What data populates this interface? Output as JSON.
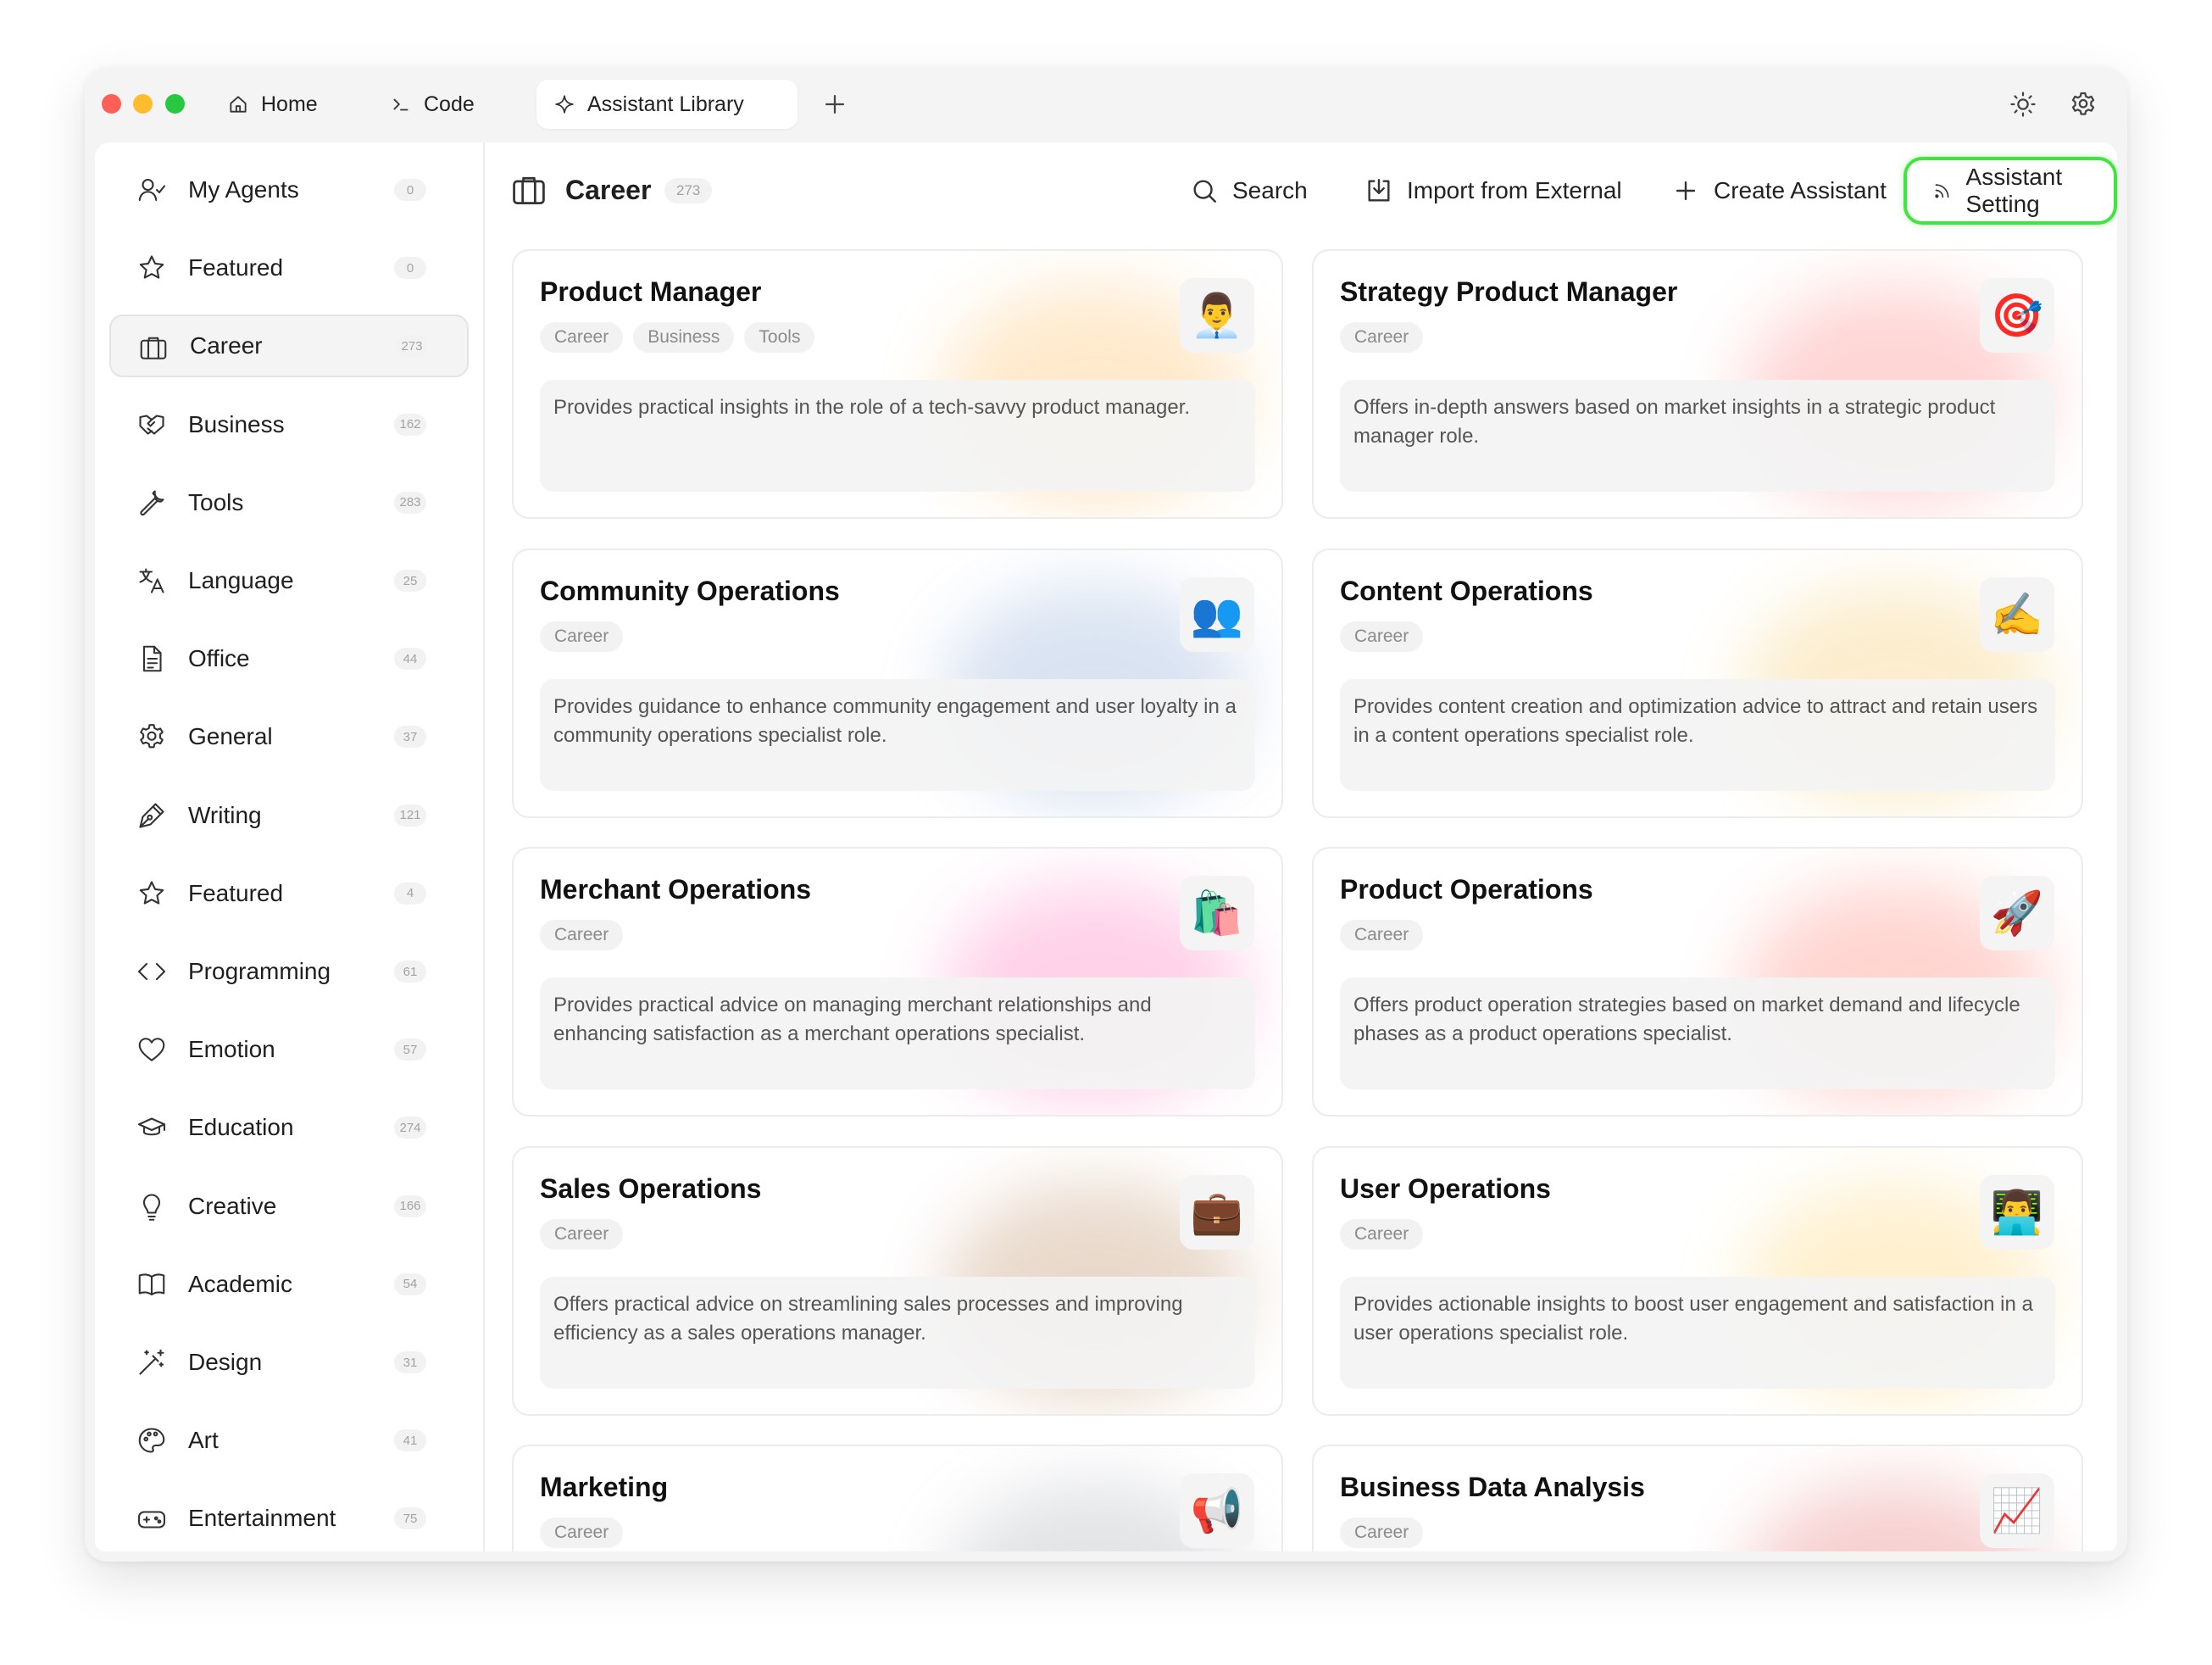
{
  "tabs": [
    {
      "label": "Home",
      "icon": "home-icon"
    },
    {
      "label": "Code",
      "icon": "terminal-icon"
    },
    {
      "label": "Assistant Library",
      "icon": "sparkle-icon"
    }
  ],
  "sidebar": {
    "items": [
      {
        "label": "My Agents",
        "count": "0",
        "icon": "user-agents-icon"
      },
      {
        "label": "Featured",
        "count": "0",
        "icon": "star-icon"
      },
      {
        "label": "Career",
        "count": "273",
        "icon": "briefcase-icon"
      },
      {
        "label": "Business",
        "count": "162",
        "icon": "handshake-icon"
      },
      {
        "label": "Tools",
        "count": "283",
        "icon": "wrench-icon"
      },
      {
        "label": "Language",
        "count": "25",
        "icon": "translate-icon"
      },
      {
        "label": "Office",
        "count": "44",
        "icon": "document-icon"
      },
      {
        "label": "General",
        "count": "37",
        "icon": "gear-icon"
      },
      {
        "label": "Writing",
        "count": "121",
        "icon": "pen-icon"
      },
      {
        "label": "Featured",
        "count": "4",
        "icon": "star-icon"
      },
      {
        "label": "Programming",
        "count": "61",
        "icon": "code-icon"
      },
      {
        "label": "Emotion",
        "count": "57",
        "icon": "heart-icon"
      },
      {
        "label": "Education",
        "count": "274",
        "icon": "graduation-cap-icon"
      },
      {
        "label": "Creative",
        "count": "166",
        "icon": "lightbulb-icon"
      },
      {
        "label": "Academic",
        "count": "54",
        "icon": "book-icon"
      },
      {
        "label": "Design",
        "count": "31",
        "icon": "magic-wand-icon"
      },
      {
        "label": "Art",
        "count": "41",
        "icon": "palette-icon"
      },
      {
        "label": "Entertainment",
        "count": "75",
        "icon": "gamepad-icon"
      }
    ]
  },
  "header": {
    "title": "Career",
    "count": "273",
    "search": "Search",
    "import": "Import from External",
    "create": "Create Assistant",
    "setting": "Assistant Setting"
  },
  "cards": [
    {
      "title": "Product Manager",
      "tags": [
        "Career",
        "Business",
        "Tools"
      ],
      "emoji": "👨‍💼",
      "desc": "Provides practical insights in the role of a tech-savvy product manager.",
      "glow": "#ffb24a"
    },
    {
      "title": "Strategy Product Manager",
      "tags": [
        "Career"
      ],
      "emoji": "🎯",
      "desc": "Offers in-depth answers based on market insights in a strategic product manager role.",
      "glow": "#ff6b6b"
    },
    {
      "title": "Community Operations",
      "tags": [
        "Career"
      ],
      "emoji": "👥",
      "desc": "Provides guidance to enhance community engagement and user loyalty in a community operations specialist role.",
      "glow": "#7a9ccf"
    },
    {
      "title": "Content Operations",
      "tags": [
        "Career"
      ],
      "emoji": "✍️",
      "desc": "Provides content creation and optimization advice to attract and retain users in a content operations specialist role.",
      "glow": "#f2c14e"
    },
    {
      "title": "Merchant Operations",
      "tags": [
        "Career"
      ],
      "emoji": "🛍️",
      "desc": "Provides practical advice on managing merchant relationships and enhancing satisfaction as a merchant operations specialist.",
      "glow": "#ff5fb0"
    },
    {
      "title": "Product Operations",
      "tags": [
        "Career"
      ],
      "emoji": "🚀",
      "desc": "Offers product operation strategies based on market demand and lifecycle phases as a product operations specialist.",
      "glow": "#ff6a5a"
    },
    {
      "title": "Sales Operations",
      "tags": [
        "Career"
      ],
      "emoji": "💼",
      "desc": "Offers practical advice on streamlining sales processes and improving efficiency as a sales operations manager.",
      "glow": "#b07a4a"
    },
    {
      "title": "User Operations",
      "tags": [
        "Career"
      ],
      "emoji": "👨‍💻",
      "desc": "Provides actionable insights to boost user engagement and satisfaction in a user operations specialist role.",
      "glow": "#ffcc55"
    },
    {
      "title": "Marketing",
      "tags": [
        "Career"
      ],
      "emoji": "📢",
      "desc": "",
      "glow": "#9aa0a6"
    },
    {
      "title": "Business Data Analysis",
      "tags": [
        "Career"
      ],
      "emoji": "📈",
      "desc": "",
      "glow": "#e05a5a"
    }
  ]
}
